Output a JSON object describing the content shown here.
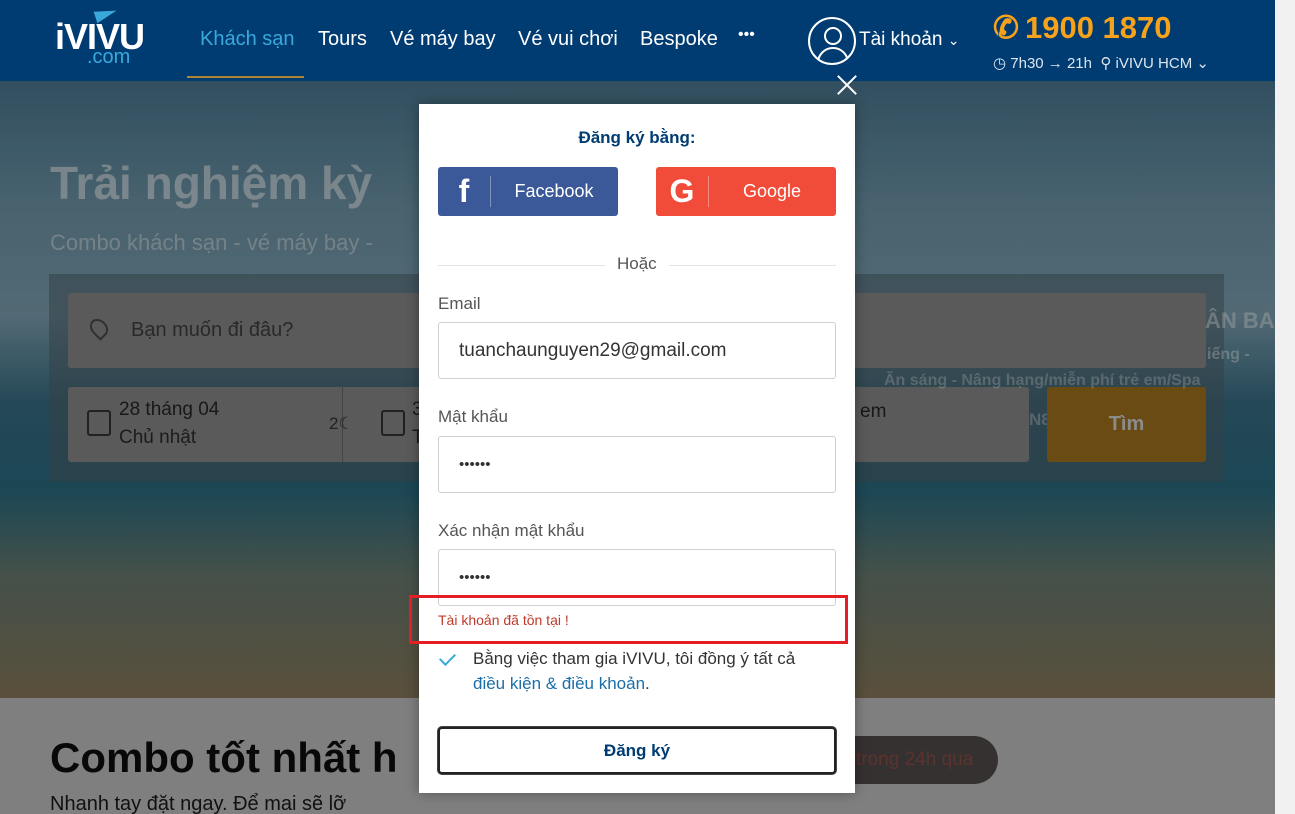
{
  "nav": {
    "logo_main": "iVIVU",
    "logo_sub": ".com",
    "items": [
      {
        "label": "Khách sạn"
      },
      {
        "label": "Tours"
      },
      {
        "label": "Vé máy bay"
      },
      {
        "label": "Vé vui chơi"
      },
      {
        "label": "Bespoke"
      },
      {
        "label": "•••"
      }
    ],
    "account_label": "Tài khoản",
    "phone": "1900 1870",
    "hours": "7h30 → 21h",
    "office": "iVIVU HCM"
  },
  "hero": {
    "title": "Trải nghiệm kỳ",
    "subtitle": "Combo khách sạn - vé máy bay -",
    "destination_placeholder": "Bạn muốn đi đâu?",
    "checkin_date": "28  tháng 04",
    "checkin_weekday": "Chủ nhật",
    "nights": "2",
    "checkout_date_partial": "3",
    "checkout_weekday_partial": "T",
    "guests_partial": "em",
    "search_label": "Tìm",
    "promo_title_partial": "ÂN BA",
    "promo_line_partial": "iếng -",
    "promo_perks": "Ăn sáng - Nâng hạng/miễn phí trẻ em/Spa",
    "extra_partial": "N8"
  },
  "section": {
    "title": "Combo tốt nhất h",
    "subtitle": "Nhanh tay đặt ngay. Để mai sẽ lỡ",
    "badge": "trong 24h qua"
  },
  "modal": {
    "title": "Đăng ký bằng:",
    "facebook_label": "Facebook",
    "google_label": "Google",
    "or_label": "Hoặc",
    "email_label": "Email",
    "email_value": "tuanchaunguyen29@gmail.com",
    "password_label": "Mật khẩu",
    "password_value": "••••••",
    "confirm_label": "Xác nhận mật khẩu",
    "confirm_value": "••••••",
    "error_message": "Tài khoản đã tồn tại !",
    "terms_text": "Bằng việc tham gia iVIVU, tôi đồng ý tất cả",
    "terms_link": "điều kiện & điều khoản",
    "terms_end": ".",
    "terms_checked": true,
    "submit_label": "Đăng ký"
  },
  "colors": {
    "brand_navy": "#003c71",
    "brand_blue": "#39a9dc",
    "brand_orange": "#f7a21b",
    "facebook": "#3b5998",
    "google": "#f14c3a",
    "error_red": "#e31e24"
  }
}
